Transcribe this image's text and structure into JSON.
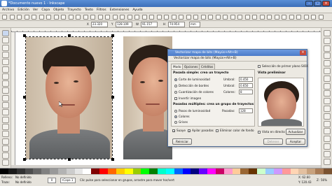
{
  "window": {
    "title": "*Documento nuevo 1 - Inkscape"
  },
  "menubar": [
    "Archivo",
    "Edición",
    "Ver",
    "Capa",
    "Objeto",
    "Trayecto",
    "Texto",
    "Filtros",
    "Extensiones",
    "Ayuda"
  ],
  "controls": {
    "x_label": "X",
    "x": "23.320",
    "y_label": "Y",
    "y": "128.109",
    "w_label": "W",
    "w": "91.157",
    "h_label": "H",
    "h": "74.954",
    "unit": "mm"
  },
  "palette": [
    "#000000",
    "#1a1a1a",
    "#333333",
    "#4d4d4d",
    "#666666",
    "#808080",
    "#999999",
    "#b3b3b3",
    "#cccccc",
    "#e6e6e6",
    "#ffffff",
    "#800000",
    "#ff0000",
    "#ff6600",
    "#ffcc00",
    "#ffff00",
    "#99cc00",
    "#00ff00",
    "#008000",
    "#00ffcc",
    "#00ffff",
    "#0066ff",
    "#0000ff",
    "#000080",
    "#6600ff",
    "#ff00ff",
    "#cc0066",
    "#ff99cc",
    "#ffcc99",
    "#996633",
    "#663300",
    "#ccffcc",
    "#99ccff",
    "#cc99ff",
    "#ff9999",
    "#ffd5b4",
    "#e3c0a0",
    "#c8a27e",
    "#a87b55",
    "#7a5230"
  ],
  "status": {
    "fill_label": "Relleno:",
    "fill_value": "No definido",
    "stroke_label": "Trazo:",
    "stroke_value": "No definido",
    "opacity": "0",
    "layer": "•Capa 1",
    "message": "Clic pulse para seleccionar en grupos, arrastre para mover hor/vert",
    "coords_x": "X: 62.60",
    "coords_y": "Y: 120.43",
    "zoom_label": "Z:",
    "zoom": "56%"
  },
  "dialog": {
    "title": "Vectorizar mapa de bits (Mayús+Alt+B)",
    "subtitle": "Vectorizar mapa de bits (Mayús+Alt+B)",
    "close": "×",
    "tabs": [
      "Modo",
      "Opciones",
      "Créditos"
    ],
    "single_scan": {
      "header": "Pasada simple: crea un trayecto",
      "brightness": "Corte de luminosidad",
      "edges": "Detección de bordes",
      "color_quant": "Cuantización de colores",
      "invert": "Invertir imagen",
      "threshold_label": "Umbral:",
      "threshold_value": "0.450",
      "edge_threshold_label": "Umbral:",
      "edge_threshold_value": "0.650",
      "colors_label": "Colores:",
      "colors_value": "8"
    },
    "multi_scan": {
      "header": "Pasadas múltiples: crea un grupo de trayectos",
      "brightness_steps": "Pasos de luminosidad",
      "colors": "Colores",
      "grays": "Grises",
      "scans_label": "Pasadas:",
      "scans_value": "128",
      "smooth": "Suaye",
      "stack": "Apilar pasadas",
      "remove_bg": "Eliminar color de fondo"
    },
    "sioxbox": "Selección de primer plano SIOX",
    "preview_header": "Vista preliminar",
    "live_preview": "Vista en directo",
    "update": "Actualizar",
    "reset": "Reiniciar",
    "stop": "Detener",
    "accept": "Aceptar"
  }
}
